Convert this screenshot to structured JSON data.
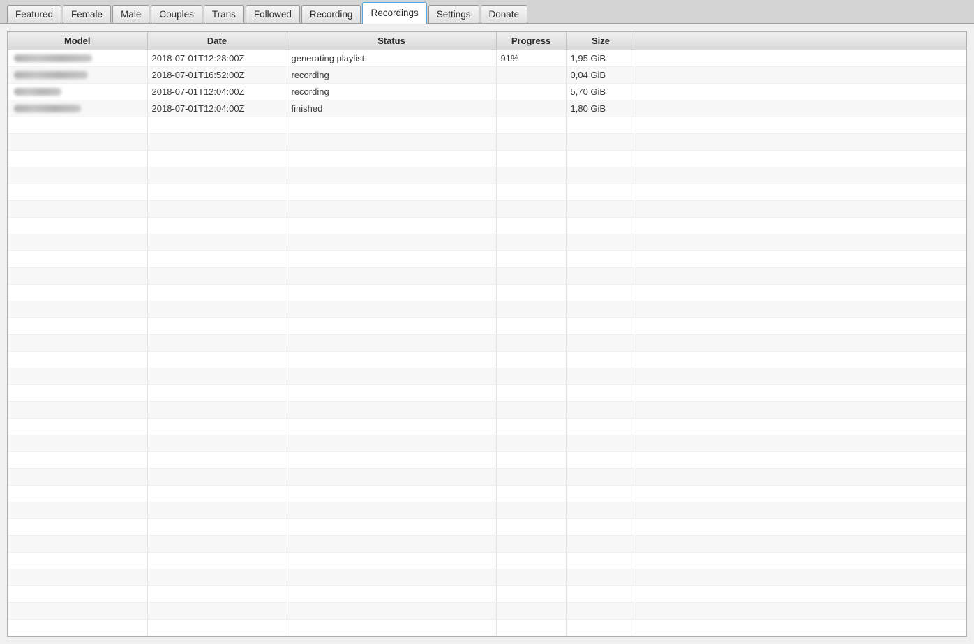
{
  "tabs": {
    "items": [
      {
        "label": "Featured",
        "active": false
      },
      {
        "label": "Female",
        "active": false
      },
      {
        "label": "Male",
        "active": false
      },
      {
        "label": "Couples",
        "active": false
      },
      {
        "label": "Trans",
        "active": false
      },
      {
        "label": "Followed",
        "active": false
      },
      {
        "label": "Recording",
        "active": false
      },
      {
        "label": "Recordings",
        "active": true
      },
      {
        "label": "Settings",
        "active": false
      },
      {
        "label": "Donate",
        "active": false
      }
    ]
  },
  "table": {
    "columns": [
      {
        "label": "Model"
      },
      {
        "label": "Date"
      },
      {
        "label": "Status"
      },
      {
        "label": "Progress"
      },
      {
        "label": "Size"
      },
      {
        "label": ""
      }
    ],
    "rows": [
      {
        "model_redacted": true,
        "model_blur_width": 112,
        "date": "2018-07-01T12:28:00Z",
        "status": "generating playlist",
        "progress": "91%",
        "size": "1,95 GiB"
      },
      {
        "model_redacted": true,
        "model_blur_width": 106,
        "date": "2018-07-01T16:52:00Z",
        "status": "recording",
        "progress": "",
        "size": "0,04 GiB"
      },
      {
        "model_redacted": true,
        "model_blur_width": 68,
        "date": "2018-07-01T12:04:00Z",
        "status": "recording",
        "progress": "",
        "size": "5,70 GiB"
      },
      {
        "model_redacted": true,
        "model_blur_width": 96,
        "date": "2018-07-01T12:04:00Z",
        "status": "finished",
        "progress": "",
        "size": "1,80 GiB"
      }
    ],
    "empty_row_count": 31
  },
  "colors": {
    "active_tab_border": "#54a6d9",
    "row_alt": "#f7f7f7",
    "window_bg": "#d4d4d4",
    "pane_bg": "#f0f0f0"
  }
}
